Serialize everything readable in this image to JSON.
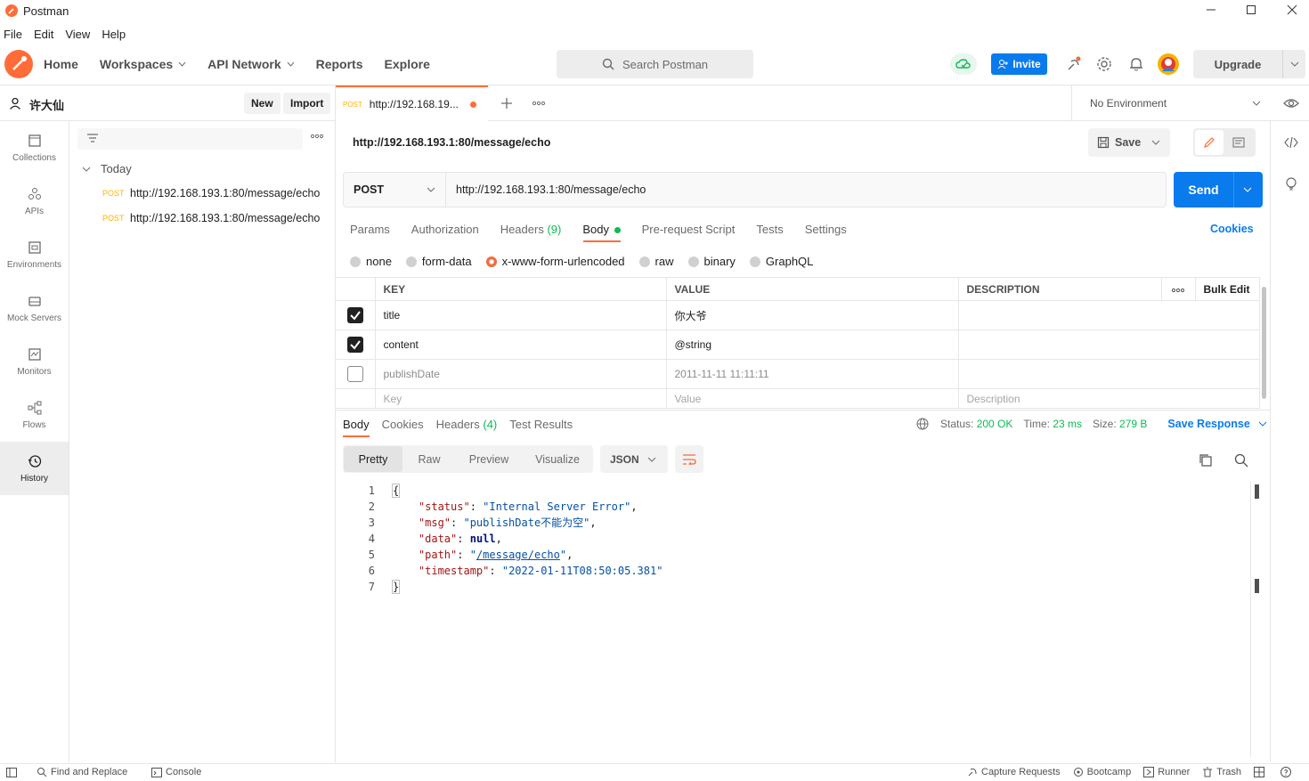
{
  "app": {
    "title": "Postman"
  },
  "menu": [
    "File",
    "Edit",
    "View",
    "Help"
  ],
  "header": {
    "nav": [
      "Home",
      "Workspaces",
      "API Network",
      "Reports",
      "Explore"
    ],
    "search_placeholder": "Search Postman",
    "invite": "Invite",
    "upgrade": "Upgrade"
  },
  "sidebar": {
    "user": "许大仙",
    "new_label": "New",
    "import_label": "Import",
    "rail": [
      "Collections",
      "APIs",
      "Environments",
      "Mock Servers",
      "Monitors",
      "Flows",
      "History"
    ],
    "group": "Today",
    "history": [
      {
        "method": "POST",
        "url": "http://192.168.193.1:80/message/echo"
      },
      {
        "method": "POST",
        "url": "http://192.168.193.1:80/message/echo"
      }
    ]
  },
  "tab": {
    "method": "POST",
    "title": "http://192.168.19..."
  },
  "environment": "No Environment",
  "request": {
    "name": "http://192.168.193.1:80/message/echo",
    "save": "Save",
    "method": "POST",
    "url": "http://192.168.193.1:80/message/echo",
    "send": "Send",
    "tabs": [
      "Params",
      "Authorization",
      "Headers",
      "Body",
      "Pre-request Script",
      "Tests",
      "Settings"
    ],
    "headers_count": "(9)",
    "cookies": "Cookies",
    "body_types": [
      "none",
      "form-data",
      "x-www-form-urlencoded",
      "raw",
      "binary",
      "GraphQL"
    ],
    "columns": [
      "KEY",
      "VALUE",
      "DESCRIPTION"
    ],
    "bulk_edit": "Bulk Edit",
    "rows": [
      {
        "key": "title",
        "value": "你大爷",
        "checked": true
      },
      {
        "key": "content",
        "value": "@string",
        "checked": true
      },
      {
        "key": "publishDate",
        "value": "2011-11-11 11:11:11",
        "checked": false
      }
    ],
    "placeholders": {
      "key": "Key",
      "value": "Value",
      "description": "Description"
    }
  },
  "response": {
    "tabs": [
      "Body",
      "Cookies",
      "Headers",
      "Test Results"
    ],
    "headers_count": "(4)",
    "status_label": "Status:",
    "status": "200 OK",
    "time_label": "Time:",
    "time": "23 ms",
    "size_label": "Size:",
    "size": "279 B",
    "save_response": "Save Response",
    "views": [
      "Pretty",
      "Raw",
      "Preview",
      "Visualize"
    ],
    "format": "JSON",
    "line_numbers": [
      "1",
      "2",
      "3",
      "4",
      "5",
      "6",
      "7"
    ],
    "json": {
      "status_key": "\"status\"",
      "status_val": "\"Internal Server Error\"",
      "msg_key": "\"msg\"",
      "msg_val": "\"publishDate不能为空\"",
      "data_key": "\"data\"",
      "data_val": "null",
      "path_key": "\"path\"",
      "path_val": "/message/echo",
      "timestamp_key": "\"timestamp\"",
      "timestamp_val": "\"2022-01-11T08:50:05.381\""
    }
  },
  "footer": {
    "find_replace": "Find and Replace",
    "console": "Console",
    "capture": "Capture Requests",
    "bootcamp": "Bootcamp",
    "runner": "Runner",
    "trash": "Trash"
  },
  "colors": {
    "accent": "#ff6c37",
    "send": "#097bed",
    "ok": "#0cbb52"
  }
}
